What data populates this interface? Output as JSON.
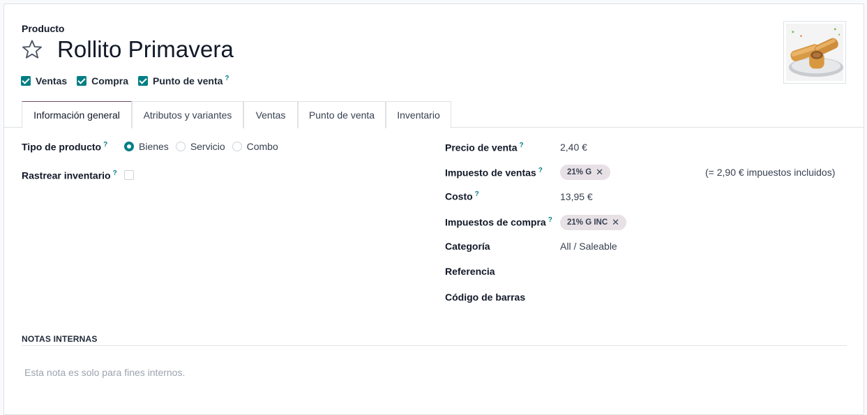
{
  "header": {
    "record_type": "Producto",
    "title": "Rollito Primavera"
  },
  "options": [
    {
      "label": "Ventas",
      "checked": true,
      "help": false
    },
    {
      "label": "Compra",
      "checked": true,
      "help": false
    },
    {
      "label": "Punto de venta",
      "checked": true,
      "help": true
    }
  ],
  "help_mark": "?",
  "tabs": [
    {
      "label": "Información general",
      "active": true
    },
    {
      "label": "Atributos y variantes",
      "active": false
    },
    {
      "label": "Ventas",
      "active": false
    },
    {
      "label": "Punto de venta",
      "active": false
    },
    {
      "label": "Inventario",
      "active": false
    }
  ],
  "left": {
    "product_type_label": "Tipo de producto",
    "product_type_options": [
      {
        "label": "Bienes",
        "selected": true
      },
      {
        "label": "Servicio",
        "selected": false
      },
      {
        "label": "Combo",
        "selected": false
      }
    ],
    "track_inventory_label": "Rastrear inventario",
    "track_inventory_checked": false
  },
  "right": {
    "sale_price_label": "Precio de venta",
    "sale_price_value": "2,40 €",
    "sales_tax_label": "Impuesto de ventas",
    "sales_tax_tag": "21% G",
    "sales_tax_note": "(= 2,90 € impuestos incluidos)",
    "cost_label": "Costo",
    "cost_value": "13,95 €",
    "purchase_tax_label": "Impuestos de compra",
    "purchase_tax_tag": "21% G INC",
    "category_label": "Categoría",
    "category_value": "All / Saleable",
    "reference_label": "Referencia",
    "barcode_label": "Código de barras"
  },
  "notes": {
    "heading": "NOTAS INTERNAS",
    "placeholder": "Esta nota es solo para fines internos."
  },
  "colors": {
    "accent": "#017e84",
    "tab_active_border": "#714b67",
    "tag_bg": "#e7e0e5"
  },
  "icons": {
    "favorite": "star-outline-icon",
    "tag_remove": "close-icon"
  }
}
